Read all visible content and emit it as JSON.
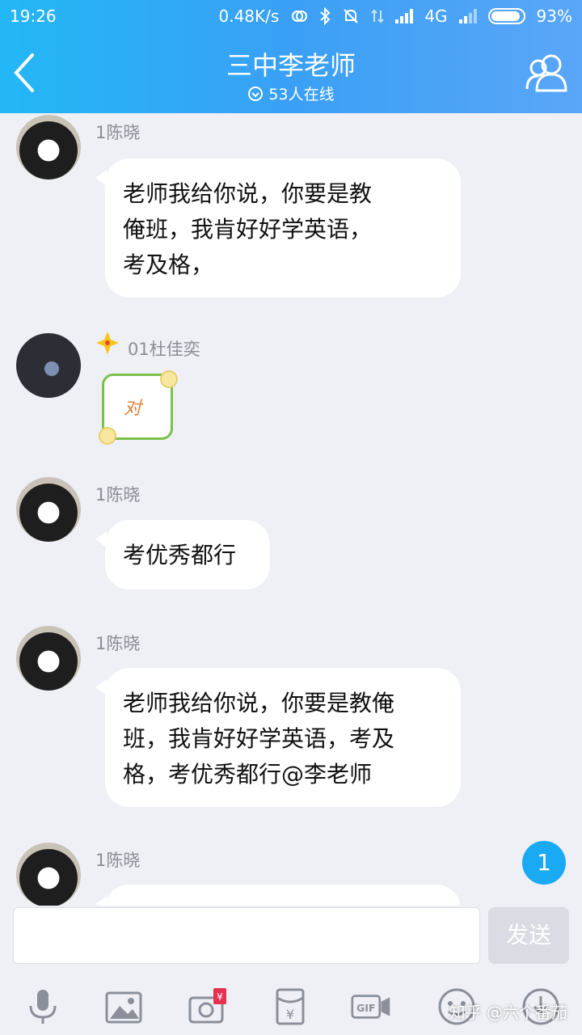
{
  "status_bar": {
    "time": "19:26",
    "speed": "0.48K/s",
    "network": "4G",
    "battery": "93%",
    "battery_level": 0.93
  },
  "header": {
    "title": "三中李老师",
    "online": "53人在线",
    "accent_color": "#2ab0f6"
  },
  "messages": [
    {
      "sender": "1陈晓",
      "lines": [
        "老师我给你说，你要是教",
        "俺班，我肯好好学英语，",
        "考及格，"
      ]
    },
    {
      "sender": "01杜佳奕",
      "sticker_text": "对"
    },
    {
      "sender": "1陈晓",
      "lines": [
        "考优秀都行"
      ]
    },
    {
      "sender": "1陈晓",
      "lines": [
        "老师我给你说，你要是教俺",
        "班，我肯好好学英语，考及",
        "格，考优秀都行@李老师"
      ]
    },
    {
      "sender": "1陈晓",
      "lines": []
    }
  ],
  "unread_count": "1",
  "input": {
    "value": "",
    "send_label": "发送"
  },
  "toolbar": [
    "mic-icon",
    "image-icon",
    "camera-icon",
    "red-packet-icon",
    "gif-icon",
    "emoji-icon",
    "more-icon"
  ],
  "watermark": "知乎 @六个番茄"
}
